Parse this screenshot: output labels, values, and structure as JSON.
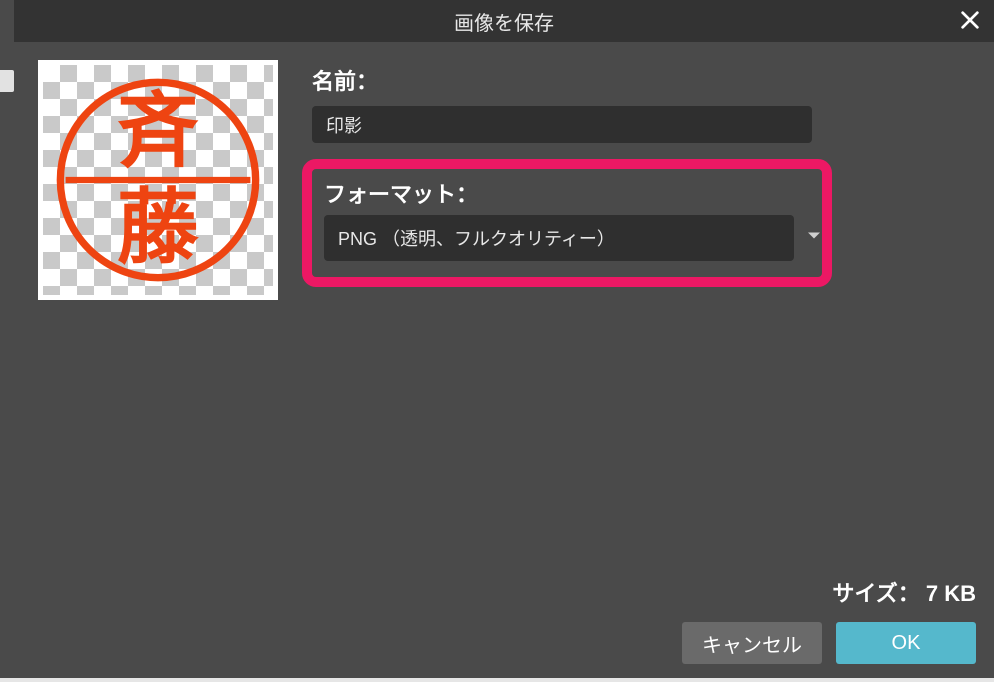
{
  "dialog": {
    "title": "画像を保存"
  },
  "preview": {
    "stamp_top_char": "斉",
    "stamp_bottom_char": "藤",
    "stamp_color": "#ee4411"
  },
  "form": {
    "name_label": "名前：",
    "name_value": "印影",
    "format_label": "フォーマット：",
    "format_selected": "PNG （透明、フルクオリティー）"
  },
  "footer": {
    "size_label": "サイズ：",
    "size_value": "7 KB",
    "cancel_label": "キャンセル",
    "ok_label": "OK"
  },
  "colors": {
    "highlight_border": "#ec1864",
    "ok_button": "#55b8cc"
  }
}
